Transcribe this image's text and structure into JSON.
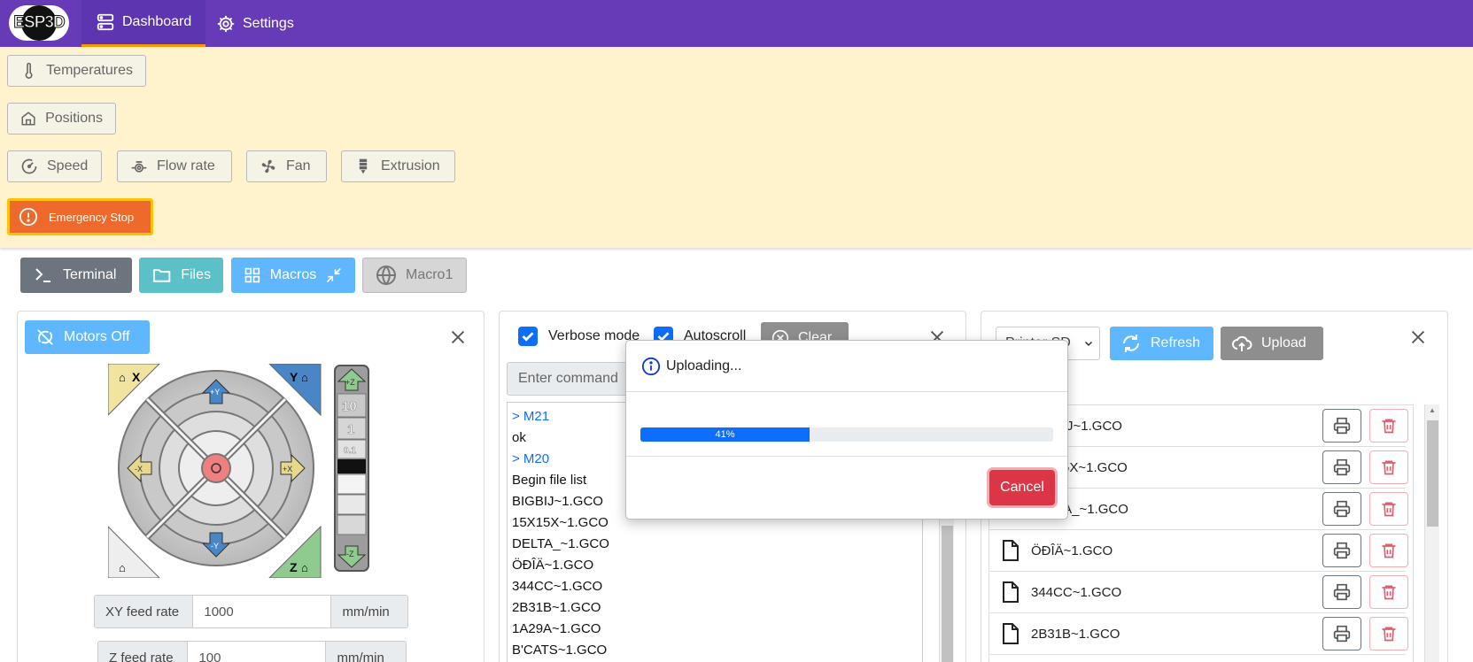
{
  "nav": {
    "logo": "ESP3D",
    "tabs": [
      {
        "label": "Dashboard"
      },
      {
        "label": "Settings"
      }
    ]
  },
  "panels": {
    "temperatures": "Temperatures",
    "positions": "Positions",
    "speed": "Speed",
    "flowrate": "Flow rate",
    "fan": "Fan",
    "extrusion": "Extrusion",
    "estop": "Emergency Stop"
  },
  "tabs": {
    "terminal": "Terminal",
    "files": "Files",
    "macros": "Macros",
    "macro1": "Macro1"
  },
  "jog": {
    "motors_off": "Motors Off",
    "labels": {
      "homeX": "X",
      "homeY": "Y",
      "homeZ": "Z",
      "yplus": "+Y",
      "yminus": "-Y",
      "xplus": "+X",
      "xminus": "-X",
      "zplus": "+Z",
      "zminus": "-Z"
    },
    "steps": [
      "10",
      "1",
      "0.1"
    ],
    "xy_feed": {
      "label": "XY feed rate",
      "value": "1000",
      "unit": "mm/min"
    },
    "z_feed": {
      "label": "Z feed rate",
      "value": "100",
      "unit": "mm/min"
    }
  },
  "terminal": {
    "verbose_label": "Verbose mode",
    "verbose": true,
    "autoscroll_label": "Autoscroll",
    "autoscroll": true,
    "clear_label": "Clear",
    "input_placeholder": "Enter command",
    "lines": [
      {
        "kind": "cmd",
        "text": "> M21"
      },
      {
        "kind": "resp",
        "text": "ok"
      },
      {
        "kind": "cmd",
        "text": "> M20"
      },
      {
        "kind": "resp",
        "text": "Begin file list"
      },
      {
        "kind": "resp",
        "text": "BIGBIJ~1.GCO"
      },
      {
        "kind": "resp",
        "text": "15X15X~1.GCO"
      },
      {
        "kind": "resp",
        "text": "DELTA_~1.GCO"
      },
      {
        "kind": "resp",
        "text": "ÖÐÎÄ~1.GCO"
      },
      {
        "kind": "resp",
        "text": "344CC~1.GCO"
      },
      {
        "kind": "resp",
        "text": "2B31B~1.GCO"
      },
      {
        "kind": "resp",
        "text": "1A29A~1.GCO"
      },
      {
        "kind": "resp",
        "text": "B'CATS~1.GCO"
      }
    ]
  },
  "files": {
    "source": "Printer SD",
    "refresh_label": "Refresh",
    "upload_label": "Upload",
    "items": [
      "BIGBIJ~1.GCO",
      "15X15X~1.GCO",
      "DELTA_~1.GCO",
      "ÖÐÎÄ~1.GCO",
      "344CC~1.GCO",
      "2B31B~1.GCO"
    ]
  },
  "modal": {
    "title": "Uploading...",
    "progress": 41,
    "progress_label": "41%",
    "cancel_label": "Cancel"
  },
  "colors": {
    "navbar": "#673ab7",
    "panel_bg": "#fff3cd",
    "estop": "#ed6a2c",
    "primary": "#0d6efd",
    "cancel": "#dc3545"
  }
}
